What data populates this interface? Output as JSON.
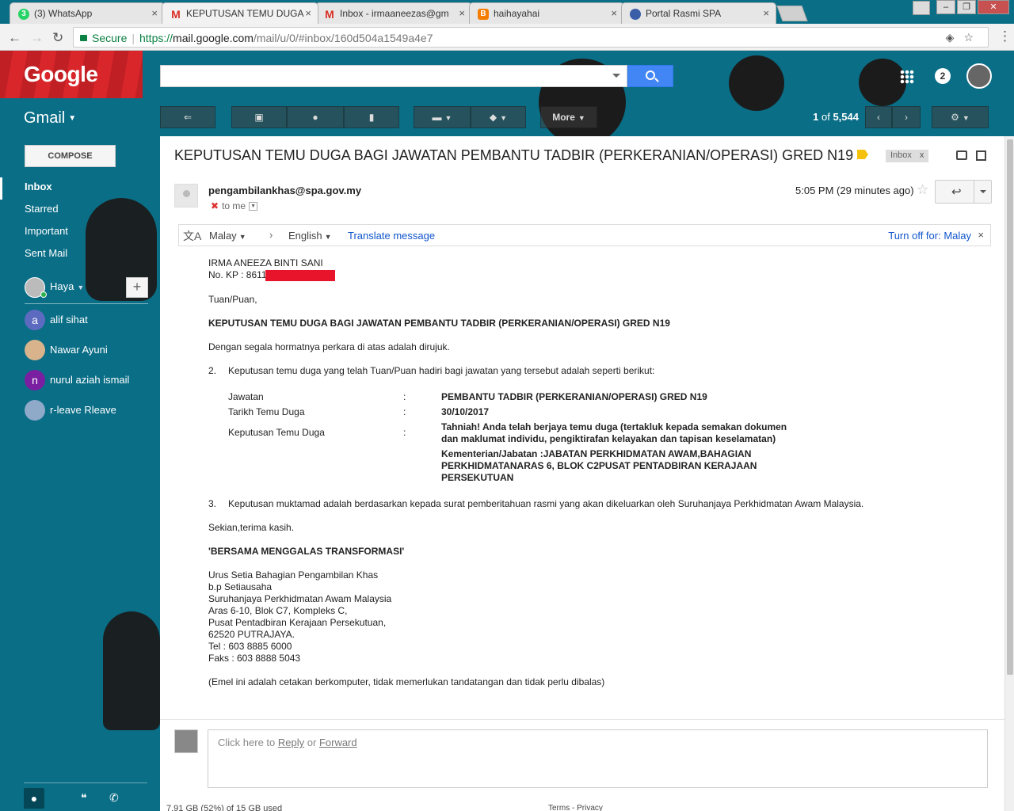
{
  "browser": {
    "tabs": [
      {
        "title": "(3) WhatsApp",
        "favicon": "whatsapp-icon",
        "color": "#25d366"
      },
      {
        "title": "KEPUTUSAN TEMU DUGA",
        "favicon": "gmail-icon",
        "color": "#d93025",
        "active": true
      },
      {
        "title": "Inbox - irmaaneezas@gm",
        "favicon": "gmail-icon",
        "color": "#d93025"
      },
      {
        "title": "haihayahai",
        "favicon": "blogger-icon",
        "color": "#f57d00"
      },
      {
        "title": "Portal Rasmi SPA",
        "favicon": "spa-icon",
        "color": "#3a5fa8"
      }
    ],
    "secure_label": "Secure",
    "url_scheme": "https://",
    "url_host": "mail.google.com",
    "url_path": "/mail/u/0/#inbox/160d504a1549a4e7"
  },
  "header": {
    "logo": "Google",
    "search_placeholder": "",
    "notification_count": "2",
    "app_label": "Gmail",
    "toolbar": {
      "more_label": "More",
      "pager_range": "1",
      "pager_of": "of",
      "pager_total": "5,544"
    }
  },
  "sidebar": {
    "compose_label": "COMPOSE",
    "nav": [
      {
        "label": "Inbox",
        "active": true
      },
      {
        "label": "Starred"
      },
      {
        "label": "Important"
      },
      {
        "label": "Sent Mail"
      }
    ],
    "me": "Haya",
    "contacts": [
      {
        "name": "alif sihat",
        "initial": "a",
        "color": "#5c6bc0"
      },
      {
        "name": "Nawar Ayuni",
        "initial": "",
        "color": "#d9b38c"
      },
      {
        "name": "nurul aziah ismail",
        "initial": "n",
        "color": "#7b1fa2"
      },
      {
        "name": "r-leave Rleave",
        "initial": "",
        "color": "#8fa9c9"
      }
    ]
  },
  "email": {
    "subject": "KEPUTUSAN TEMU DUGA BAGI JAWATAN PEMBANTU TADBIR (PERKERANIAN/OPERASI) GRED N19",
    "label_chip": "Inbox",
    "label_chip_x": "x",
    "sender": "pengambilankhas@spa.gov.my",
    "to": "to me",
    "time": "5:05 PM (29 minutes ago)",
    "translate": {
      "from": "Malay",
      "to": "English",
      "link": "Translate message",
      "turnoff": "Turn off for: Malay",
      "close": "×"
    },
    "body": {
      "name": "IRMA ANEEZA BINTI SANI",
      "kp_label": "No. KP : 861118",
      "salutation": "Tuan/Puan,",
      "heading": "KEPUTUSAN TEMU DUGA BAGI JAWATAN PEMBANTU TADBIR (PERKERANIAN/OPERASI) GRED N19",
      "intro": "Dengan segala hormatnya perkara di atas adalah dirujuk.",
      "p2_num": "2.",
      "p2": "Keputusan temu duga yang telah Tuan/Puan hadiri bagi jawatan yang tersebut adalah seperti berikut:",
      "details": [
        {
          "label": "Jawatan",
          "value": "PEMBANTU TADBIR (PERKERANIAN/OPERASI) GRED N19"
        },
        {
          "label": "Tarikh Temu Duga",
          "value": "30/10/2017"
        },
        {
          "label": "Keputusan Temu Duga",
          "value": "Tahniah! Anda telah berjaya temu duga (tertakluk kepada semakan dokumen"
        }
      ],
      "colon": ":",
      "result_line2": "dan maklumat individu, pengiktirafan kelayakan dan tapisan keselamatan)",
      "kementerian_1": "Kementerian/Jabatan :JABATAN PERKHIDMATAN AWAM,BAHAGIAN",
      "kementerian_2": "PERKHIDMATANARAS 6, BLOK C2PUSAT PENTADBIRAN KERAJAAN",
      "kementerian_3": "PERSEKUTUAN",
      "p3_num": "3.",
      "p3": "Keputusan muktamad adalah berdasarkan kepada surat pemberitahuan rasmi yang akan dikeluarkan oleh Suruhanjaya Perkhidmatan Awam Malaysia.",
      "closing": "Sekian,terima kasih.",
      "motto": "'BERSAMA MENGGALAS TRANSFORMASI'",
      "signature": [
        "Urus Setia Bahagian Pengambilan Khas",
        "b.p Setiausaha",
        "Suruhanjaya Perkhidmatan Awam Malaysia",
        "Aras 6-10, Blok C7, Kompleks C,",
        "Pusat Pentadbiran Kerajaan Persekutuan,",
        "62520 PUTRAJAYA.",
        "Tel : 603 8885 6000",
        "Faks : 603 8888 5043"
      ],
      "note": "(Emel ini adalah cetakan berkomputer, tidak memerlukan tandatangan dan tidak perlu dibalas)"
    },
    "reply": {
      "prefix": "Click here to",
      "reply_link": "Reply",
      "or": "or",
      "forward_link": "Forward"
    }
  },
  "footer": {
    "storage": "7.91 GB (52%) of 15 GB used",
    "links": "Terms - Privacy"
  }
}
